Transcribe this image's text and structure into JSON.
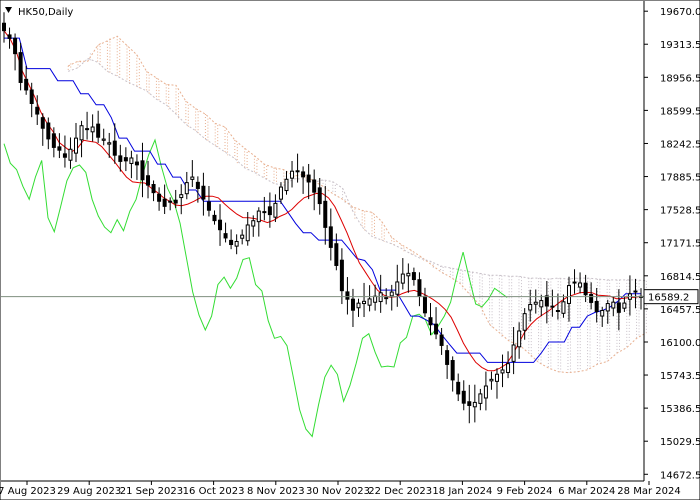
{
  "symbol_label": "HK50,Daily",
  "chart_data": {
    "type": "candlestick",
    "title": "",
    "symbol": "HK50",
    "timeframe": "Daily",
    "indicator": "Ichimoku Kinko Hyo",
    "x_tick_labels": [
      "7 Aug 2023",
      "29 Aug 2023",
      "21 Sep 2023",
      "16 Oct 2023",
      "8 Nov 2023",
      "30 Nov 2023",
      "22 Dec 2023",
      "18 Jan 2024",
      "9 Feb 2024",
      "6 Mar 2024",
      "28 Mar 2024"
    ],
    "y_tick_labels": [
      "19670.0",
      "19313.5",
      "18956.5",
      "18599.5",
      "18242.5",
      "17885.5",
      "17528.5",
      "17171.5",
      "16814.5",
      "16457.5",
      "16100.0",
      "15743.5",
      "15386.5",
      "15029.5",
      "14672.5"
    ],
    "y_range": [
      14600,
      19780
    ],
    "current_price": 16589.2,
    "current_price_label": "16589.2",
    "grid": false,
    "colors": {
      "background": "#ffffff",
      "candles": "#000000",
      "tenkan_sen": "#dd0000",
      "kijun_sen": "#0000dd",
      "chikou_span": "#33dd33",
      "kumo_senkou_a": "#e8b090",
      "kumo_senkou_b": "#c8c0c8",
      "current_price_line": "#7f8f7f"
    },
    "series": [
      {
        "name": "candles",
        "values": [
          19460,
          19376,
          19212,
          18901,
          18820,
          18674,
          18560,
          18407,
          18292,
          18200,
          18170,
          18094,
          18180,
          18300,
          18434,
          18400,
          18420,
          18310,
          18290,
          18250,
          18116,
          18049,
          18055,
          18086,
          18012,
          17851,
          17793,
          17712,
          17619,
          17564,
          17620,
          17600,
          17690,
          17820,
          17880,
          17757,
          17643,
          17522,
          17410,
          17312,
          17223,
          17152,
          17185,
          17253,
          17363,
          17409,
          17513,
          17507,
          17475,
          17596,
          17772,
          17856,
          17943,
          17945,
          17882,
          17827,
          17717,
          17594,
          17337,
          17121,
          16926,
          16654,
          16562,
          16443,
          16519,
          16539,
          16565,
          16594,
          16631,
          16579,
          16639,
          16748,
          16833,
          16841,
          16774,
          16591,
          16415,
          16286,
          16187,
          16063,
          15858,
          15691,
          15540,
          15440,
          15415,
          15448,
          15540,
          15625,
          15697,
          15752,
          15798,
          15866,
          16068,
          16219,
          16406,
          16505,
          16529,
          16547,
          16489,
          16487,
          16440,
          16534,
          16709,
          16747,
          16737,
          16610,
          16527,
          16429,
          16440,
          16515,
          16530,
          16420,
          16520,
          16620,
          16650,
          16589
        ]
      },
      {
        "name": "tenkan_sen",
        "values": [
          19460,
          19372,
          19235,
          19020,
          18884,
          18748,
          18582,
          18463,
          18372,
          18254,
          18201,
          18152,
          18192,
          18277,
          18265,
          18255,
          18205,
          18127,
          18049,
          17963,
          17880,
          17828,
          17820,
          17816,
          17763,
          17716,
          17659,
          17620,
          17579,
          17571,
          17588,
          17618,
          17654,
          17672,
          17674,
          17655,
          17590,
          17533,
          17480,
          17442,
          17441,
          17432,
          17412,
          17389,
          17412,
          17454,
          17483,
          17531,
          17599,
          17656,
          17681,
          17704,
          17701,
          17654,
          17562,
          17423,
          17278,
          17112,
          16955,
          16853,
          16752,
          16658,
          16606,
          16583,
          16588,
          16622,
          16646,
          16657,
          16633,
          16601,
          16562,
          16514,
          16453,
          16368,
          16231,
          16088,
          15977,
          15882,
          15826,
          15791,
          15790,
          15818,
          15862,
          15960,
          16082,
          16206,
          16289,
          16352,
          16397,
          16439,
          16492,
          16544,
          16586,
          16609,
          16631,
          16637,
          16632,
          16605,
          16601,
          16593,
          16567,
          16569,
          16580,
          16581,
          16593
        ]
      },
      {
        "name": "kijun_sen",
        "values": [
          19380,
          19380,
          19380,
          19050,
          19050,
          19050,
          19050,
          18920,
          18920,
          18920,
          18780,
          18780,
          18660,
          18660,
          18520,
          18300,
          18300,
          18160,
          18160,
          18160,
          18020,
          18020,
          17880,
          17880,
          17740,
          17740,
          17620,
          17620,
          17620,
          17620,
          17620,
          17620,
          17620,
          17620,
          17620,
          17620,
          17620,
          17500,
          17380,
          17280,
          17280,
          17200,
          17200,
          17200,
          17200,
          17100,
          17000,
          16980,
          16880,
          16660,
          16660,
          16660,
          16520,
          16380,
          16380,
          16340,
          16290,
          16180,
          16080,
          15980,
          15980,
          15980,
          15980,
          15880,
          15880,
          15880,
          15880,
          15880,
          15880,
          15880,
          15980,
          16100,
          16100,
          16100,
          16260,
          16260,
          16380,
          16420,
          16440,
          16480,
          16540,
          16620,
          16620,
          16620
        ]
      },
      {
        "name": "chikou_span",
        "values": [
          18240,
          18030,
          17960,
          17780,
          17640,
          17880,
          18060,
          17440,
          17290,
          17560,
          17840,
          17980,
          18010,
          17930,
          17640,
          17460,
          17340,
          17280,
          17420,
          17300,
          17510,
          17640,
          17900,
          18120,
          18280,
          18000,
          17760,
          17620,
          17380,
          17010,
          16640,
          16390,
          16230,
          16380,
          16720,
          16800,
          16680,
          16790,
          16990,
          17010,
          16720,
          16650,
          16330,
          16140,
          16160,
          16060,
          15720,
          15370,
          15160,
          15080,
          15420,
          15720,
          15850,
          15750,
          15460,
          15630,
          15870,
          16140,
          16190,
          15990,
          15830,
          15840,
          15830,
          16090,
          16150,
          16380,
          16400,
          16340,
          16180,
          16270,
          16380,
          16530,
          16820,
          17070,
          16780,
          16510,
          16480,
          16560,
          16680,
          16630,
          16580
        ]
      },
      {
        "name": "senkou_span_a",
        "values": [
          19080,
          19130,
          19130,
          19300,
          19350,
          19400,
          19300,
          19200,
          19020,
          18950,
          18880,
          18870,
          18700,
          18620,
          18560,
          18460,
          18420,
          18280,
          18190,
          18110,
          18020,
          17980,
          17960,
          17890,
          17910,
          17840,
          17780,
          17700,
          17640,
          17560,
          17520,
          17500,
          17400,
          17230,
          17150,
          17090,
          17020,
          16940,
          16860,
          16800,
          16730,
          16610,
          16500,
          16290,
          16200,
          16110,
          16070,
          15980,
          15880,
          15820,
          15780,
          15770,
          15780,
          15800,
          15860,
          15890,
          15980,
          16040,
          16140,
          16200
        ]
      },
      {
        "name": "senkou_span_b",
        "values": [
          19020,
          19060,
          19160,
          19120,
          19020,
          18970,
          18910,
          18860,
          18810,
          18720,
          18660,
          18560,
          18450,
          18380,
          18290,
          18220,
          18150,
          18080,
          17980,
          17930,
          17870,
          17810,
          17790,
          17860,
          17860,
          17820,
          17850,
          17830,
          17760,
          17520,
          17340,
          17240,
          17200,
          17160,
          17110,
          17050,
          17000,
          16970,
          16920,
          16900,
          16880,
          16860,
          16840,
          16820,
          16820,
          16810,
          16810,
          16790,
          16790,
          16780,
          16790,
          16780,
          16790,
          16790,
          16780,
          16770,
          16770,
          16770,
          16770,
          16760
        ]
      }
    ]
  }
}
